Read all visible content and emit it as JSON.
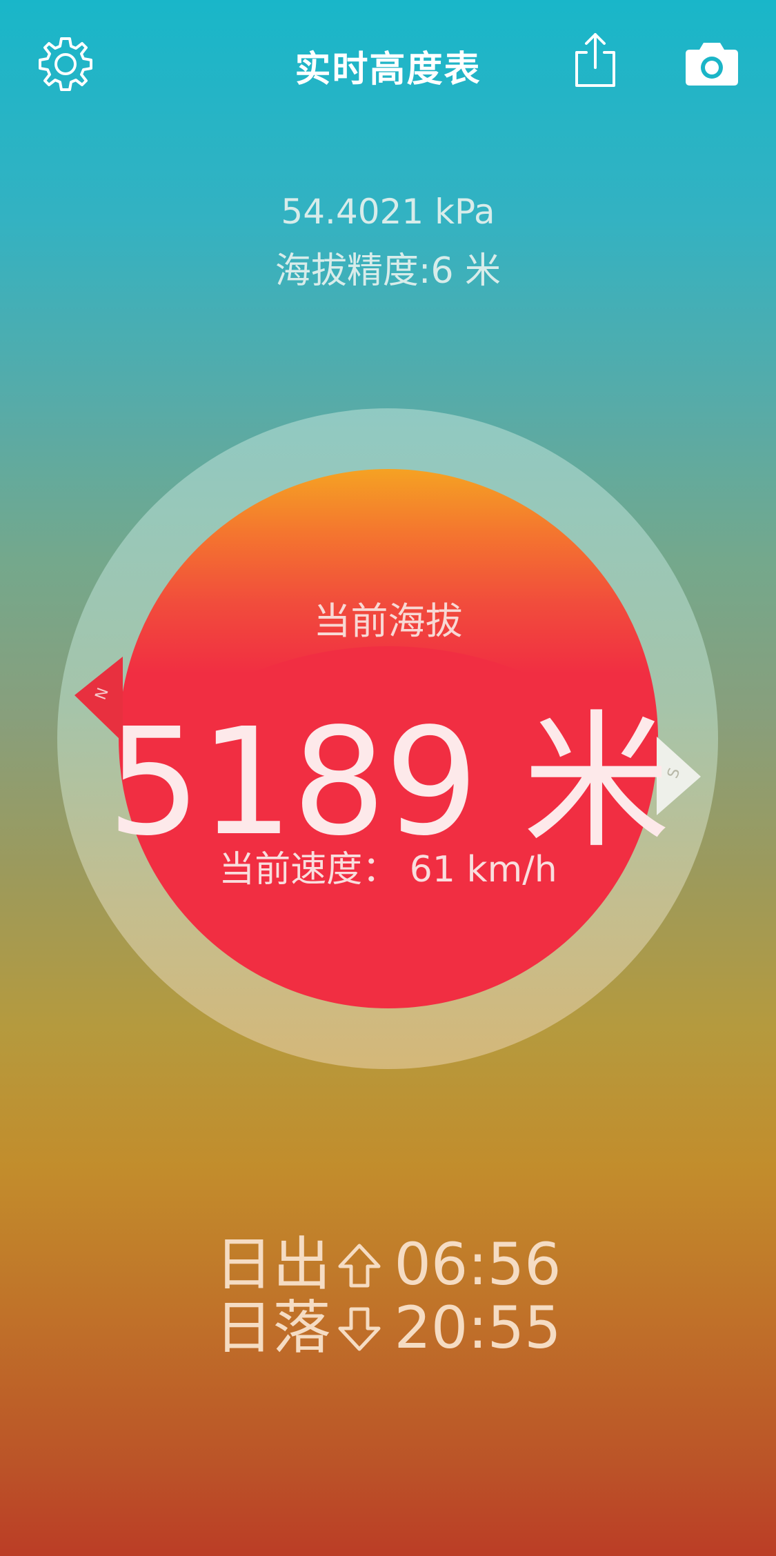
{
  "header": {
    "title": "实时高度表",
    "settings_icon": "gear-icon",
    "share_icon": "share-icon",
    "camera_icon": "camera-icon"
  },
  "readouts": {
    "pressure": "54.4021 kPa",
    "accuracy": "海拔精度:6 米"
  },
  "dial": {
    "label": "当前海拔",
    "altitude": "5189 米",
    "speed": "当前速度： 61 km/h",
    "north_marker": "N",
    "south_marker": "S"
  },
  "sun": {
    "sunrise_label": "日出",
    "sunrise_time": "06:56",
    "sunset_label": "日落",
    "sunset_time": "20:55"
  },
  "colors": {
    "dial_red": "#f12e42",
    "dial_top_orange": "#f5a223",
    "north_marker": "#e8303f",
    "south_marker": "#eef0ea"
  }
}
